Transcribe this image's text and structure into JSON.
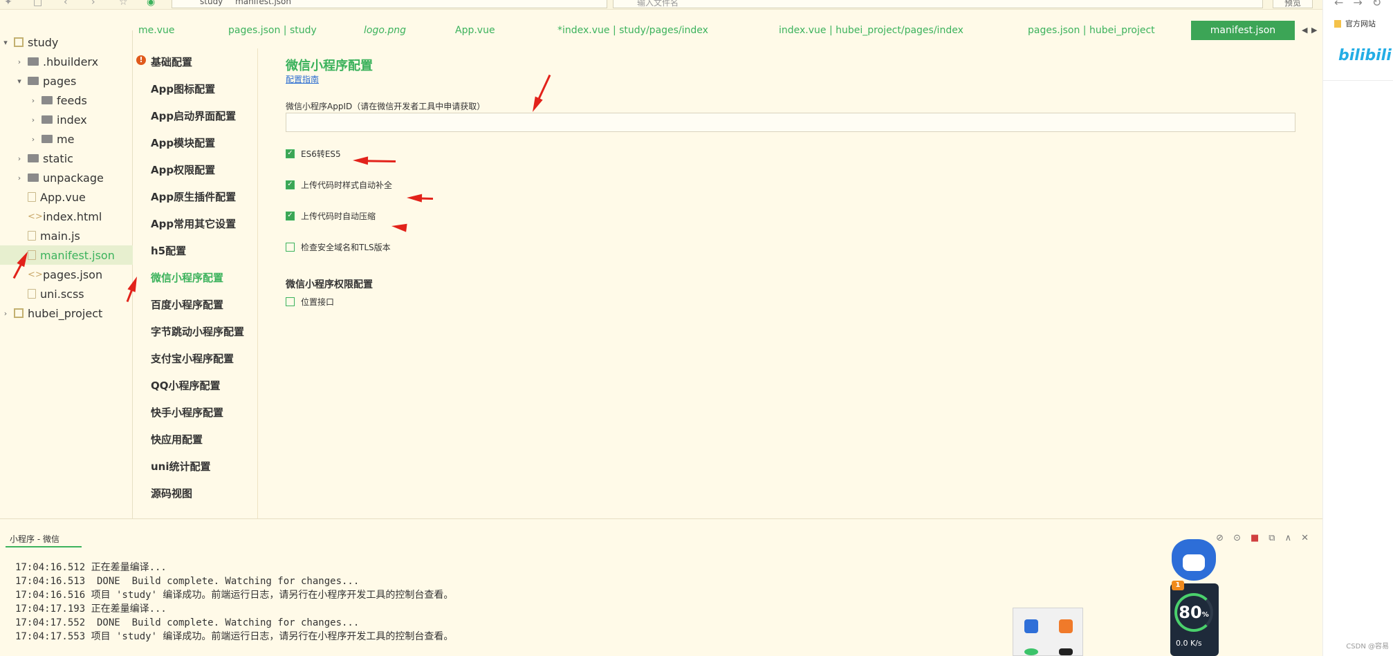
{
  "toolbar": {
    "breadcrumb": [
      "study",
      "manifest.json"
    ],
    "search_placeholder": "输入文件名",
    "preview_label": "预览"
  },
  "tree": {
    "items": [
      {
        "label": "study",
        "type": "project",
        "chevron": "▾"
      },
      {
        "label": ".hbuilderx",
        "type": "folder",
        "chevron": "›"
      },
      {
        "label": "pages",
        "type": "folder",
        "chevron": "▾"
      },
      {
        "label": "feeds",
        "type": "folder",
        "chevron": "›"
      },
      {
        "label": "index",
        "type": "folder",
        "chevron": "›"
      },
      {
        "label": "me",
        "type": "folder",
        "chevron": "›"
      },
      {
        "label": "static",
        "type": "folder",
        "chevron": "›"
      },
      {
        "label": "unpackage",
        "type": "folder",
        "chevron": "›"
      },
      {
        "label": "App.vue",
        "type": "file",
        "chevron": ""
      },
      {
        "label": "index.html",
        "type": "code",
        "chevron": ""
      },
      {
        "label": "main.js",
        "type": "file",
        "chevron": ""
      },
      {
        "label": "manifest.json",
        "type": "file",
        "chevron": "",
        "selected": true
      },
      {
        "label": "pages.json",
        "type": "code",
        "chevron": ""
      },
      {
        "label": "uni.scss",
        "type": "file",
        "chevron": ""
      },
      {
        "label": "hubei_project",
        "type": "project",
        "chevron": "›"
      }
    ]
  },
  "tabs": [
    {
      "label": "me.vue"
    },
    {
      "label": "pages.json | study"
    },
    {
      "label": "logo.png",
      "italic": true
    },
    {
      "label": "App.vue"
    },
    {
      "label": "*index.vue | study/pages/index"
    },
    {
      "label": "index.vue | hubei_project/pages/index"
    },
    {
      "label": "pages.json | hubei_project"
    },
    {
      "label": "manifest.json",
      "active": true
    }
  ],
  "settings_nav": [
    {
      "label": "基础配置",
      "warning": true
    },
    {
      "label": "App图标配置"
    },
    {
      "label": "App启动界面配置"
    },
    {
      "label": "App模块配置"
    },
    {
      "label": "App权限配置"
    },
    {
      "label": "App原生插件配置"
    },
    {
      "label": "App常用其它设置"
    },
    {
      "label": "h5配置"
    },
    {
      "label": "微信小程序配置",
      "active": true
    },
    {
      "label": "百度小程序配置"
    },
    {
      "label": "字节跳动小程序配置"
    },
    {
      "label": "支付宝小程序配置"
    },
    {
      "label": "QQ小程序配置"
    },
    {
      "label": "快手小程序配置"
    },
    {
      "label": "快应用配置"
    },
    {
      "label": "uni统计配置"
    },
    {
      "label": "源码视图"
    }
  ],
  "main": {
    "title": "微信小程序配置",
    "guide_link": "配置指南",
    "appid_label": "微信小程序AppID（请在微信开发者工具中申请获取）",
    "appid_value": "",
    "checkboxes": [
      {
        "label": "ES6转ES5",
        "checked": true
      },
      {
        "label": "上传代码时样式自动补全",
        "checked": true
      },
      {
        "label": "上传代码时自动压缩",
        "checked": true
      },
      {
        "label": "检查安全域名和TLS版本",
        "checked": false
      }
    ],
    "permissions_title": "微信小程序权限配置",
    "permissions": [
      {
        "label": "位置接口",
        "checked": false
      }
    ]
  },
  "console": {
    "tab_label": "小程序 - 微信",
    "lines": [
      "17:04:16.512 正在差量编译...",
      "17:04:16.513  DONE  Build complete. Watching for changes...",
      "17:04:16.516 项目 'study' 编译成功。前端运行日志，请另行在小程序开发工具的控制台查看。",
      "17:04:17.193 正在差量编译...",
      "17:04:17.552  DONE  Build complete. Watching for changes...",
      "17:04:17.553 项目 'study' 编译成功。前端运行日志，请另行在小程序开发工具的控制台查看。"
    ]
  },
  "right_panel": {
    "bookmark": "官方网站",
    "logo": "bilibili",
    "watermark": "CSDN @容易"
  },
  "mascot": {
    "badge": "1",
    "percent": "80",
    "percent_unit": "%",
    "speed": "0.0 K/s"
  },
  "colors": {
    "accent": "#3bb25c",
    "active_tab": "#3ca556",
    "background": "#fffae8",
    "annotation": "#e2221a",
    "warning": "#e05a1c"
  }
}
